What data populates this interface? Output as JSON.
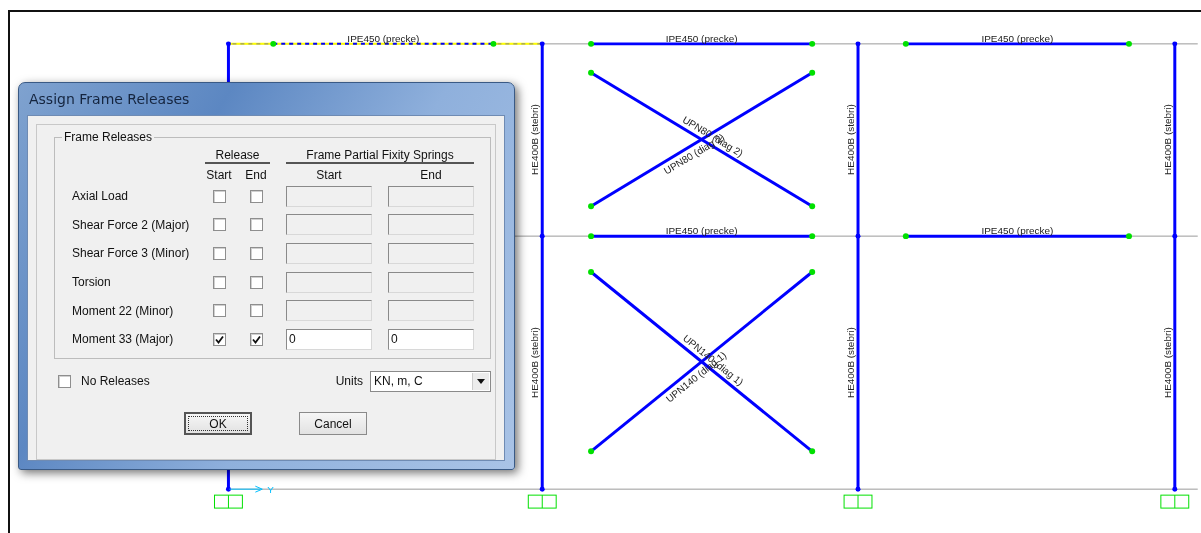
{
  "canvas": {
    "beams": [
      {
        "label": "IPE450 (precke)",
        "selected": true
      },
      {
        "label": "IPE450 (precke)",
        "selected": false
      },
      {
        "label": "IPE450 (precke)",
        "selected": false
      },
      {
        "label": "IPE450 (precke)",
        "selected": false
      },
      {
        "label": "IPE450 (precke)",
        "selected": false
      }
    ],
    "columns": [
      {
        "label": "HE400B (stebri)"
      },
      {
        "label": "HE400B (stebri)"
      },
      {
        "label": "HE400B (stebri)"
      },
      {
        "label": "HE400B (stebri)"
      },
      {
        "label": "HE400B (stebri)"
      },
      {
        "label": "HE400B (stebri)"
      }
    ],
    "braces": [
      {
        "label": "UPN80 (diag 2)"
      },
      {
        "label": "UPN80 (diag 2)"
      },
      {
        "label": "UPN140 (diag 1)"
      },
      {
        "label": "UPN140 (diag 1)"
      }
    ],
    "axis_label": "Y"
  },
  "dialog": {
    "title": "Assign Frame Releases",
    "group_title": "Frame Releases",
    "release_heading": "Release",
    "springs_heading": "Frame Partial Fixity Springs",
    "subheadings": [
      "Start",
      "End",
      "Start",
      "End"
    ],
    "rows": [
      {
        "label": "Axial Load",
        "release_start": false,
        "release_end": false,
        "spring_start": {
          "disabled": true
        },
        "spring_end": {
          "disabled": true
        }
      },
      {
        "label": "Shear Force 2 (Major)",
        "release_start": false,
        "release_end": false,
        "spring_start": {
          "disabled": true
        },
        "spring_end": {
          "disabled": true
        }
      },
      {
        "label": "Shear Force 3 (Minor)",
        "release_start": false,
        "release_end": false,
        "spring_start": {
          "disabled": true
        },
        "spring_end": {
          "disabled": true
        }
      },
      {
        "label": "Torsion",
        "release_start": false,
        "release_end": false,
        "spring_start": {
          "disabled": true
        },
        "spring_end": {
          "disabled": true
        }
      },
      {
        "label": "Moment 22 (Minor)",
        "release_start": false,
        "release_end": false,
        "spring_start": {
          "disabled": true
        },
        "spring_end": {
          "disabled": true
        }
      },
      {
        "label": "Moment 33 (Major)",
        "release_start": true,
        "release_end": true,
        "spring_start": {
          "value": "0",
          "disabled": false
        },
        "spring_end": {
          "value": "0",
          "disabled": false
        }
      }
    ],
    "no_releases": {
      "label": "No Releases",
      "checked": false
    },
    "units": {
      "label": "Units",
      "value": "KN, m, C"
    },
    "buttons": [
      {
        "label": "OK",
        "default": true
      },
      {
        "label": "Cancel",
        "default": false
      }
    ]
  }
}
